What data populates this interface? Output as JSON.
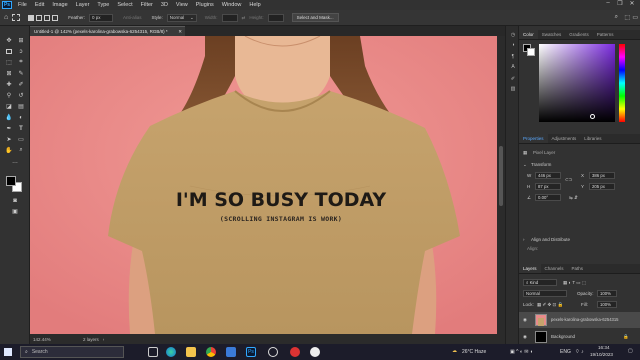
{
  "menu": {
    "logo": "Ps",
    "items": [
      "File",
      "Edit",
      "Image",
      "Layer",
      "Type",
      "Select",
      "Filter",
      "3D",
      "View",
      "Plugins",
      "Window",
      "Help"
    ]
  },
  "options": {
    "feather_label": "Feather:",
    "feather_value": "0 px",
    "antialias_label": "Anti-alias",
    "style_label": "Style:",
    "style_value": "Normal",
    "width_label": "Width:",
    "height_label": "Height:",
    "select_mask_label": "Select and Mask..."
  },
  "document": {
    "tab_title": "Untitled-1 @ 142% (pexels-karolina-grabowska-6254315, RGB/8) *",
    "shirt_line1": "I'M SO BUSY TODAY",
    "shirt_line2": "(SCROLLING INSTAGRAM IS WORK)"
  },
  "status": {
    "zoom": "142.44%",
    "info": "2 layers"
  },
  "color_panel": {
    "tabs": [
      "Color",
      "Swatches",
      "Gradients",
      "Patterns"
    ],
    "hue_accent": "#7b2be0"
  },
  "properties_panel": {
    "tabs": [
      "Properties",
      "Adjustments",
      "Libraries"
    ],
    "layer_type": "Pixel Layer",
    "transform_label": "Transform",
    "w_label": "W",
    "w_value": "446 px",
    "x_label": "X",
    "x_value": "386 px",
    "h_label": "H",
    "h_value": "87 px",
    "y_label": "Y",
    "y_value": "205 px",
    "angle_value": "0.00°",
    "align_label": "Align and Distribute",
    "align_sub": "Align:"
  },
  "layers_panel": {
    "tabs": [
      "Layers",
      "Channels",
      "Paths"
    ],
    "filter_label": "Kind",
    "blend_mode": "Normal",
    "opacity_label": "Opacity:",
    "opacity_value": "100%",
    "lock_label": "Lock:",
    "fill_label": "Fill:",
    "fill_value": "100%",
    "layers": [
      {
        "name": "pexels-karolina-grabowska-6254315"
      },
      {
        "name": "Background"
      }
    ]
  },
  "taskbar": {
    "search_placeholder": "Search",
    "weather": "26°C  Haze",
    "lang": "ENG",
    "time": "16:34",
    "date": "19/10/2023"
  }
}
